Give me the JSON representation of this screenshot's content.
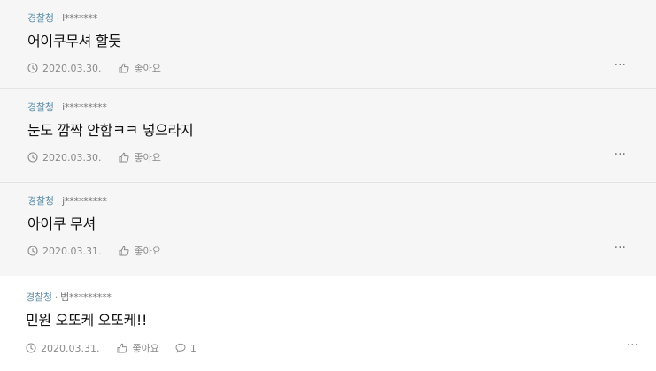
{
  "comments": [
    {
      "author": "경찰청",
      "user_id": "l*******",
      "text": "어이쿠무셔 할듯",
      "date": "2020.03.30.",
      "like_label": "좋아요",
      "more_label": "···"
    },
    {
      "author": "경찰청",
      "user_id": "i*********",
      "text": "눈도 깜짝 안함ㅋㅋ 넣으라지",
      "date": "2020.03.30.",
      "like_label": "좋아요",
      "more_label": "···"
    },
    {
      "author": "경찰청",
      "user_id": "j*********",
      "text": "아이쿠 무셔",
      "date": "2020.03.31.",
      "like_label": "좋아요",
      "more_label": "···"
    },
    {
      "author": "경찰청",
      "user_id": "법*********",
      "text": "민원 오또케 오또케!!",
      "date": "2020.03.31.",
      "like_label": "좋아요",
      "reply_count": "1",
      "more_label": "···"
    }
  ],
  "separator": "·"
}
